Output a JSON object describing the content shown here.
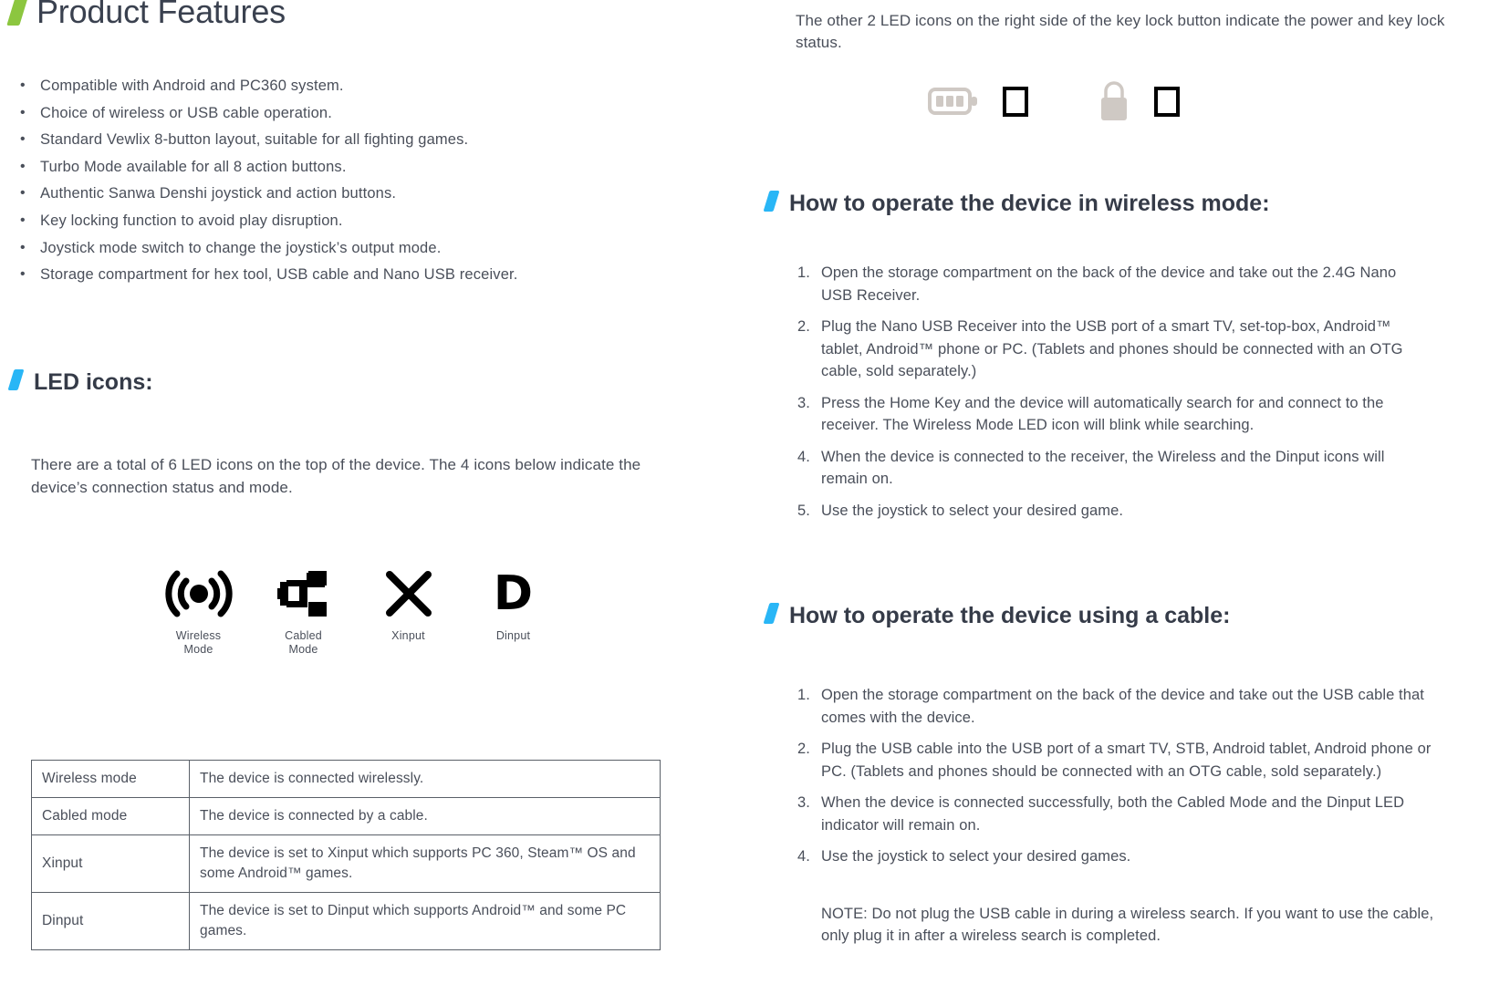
{
  "left": {
    "product_features": {
      "title": "Product Features",
      "accent_color": "#8cc63f",
      "items": [
        "Compatible with Android and PC360 system.",
        "Choice of wireless or USB cable operation.",
        "Standard Vewlix 8-button layout, suitable for all fighting games.",
        "Turbo Mode available for all 8 action buttons.",
        "Authentic Sanwa Denshi joystick and action buttons.",
        "Key locking function to avoid play disruption.",
        "Joystick mode switch to change the joystick’s output mode.",
        "Storage compartment for hex tool, USB cable and Nano USB receiver."
      ]
    },
    "led_icons": {
      "title": "LED icons:",
      "accent_color": "#29b6f6",
      "intro": "There are a total of 6 LED icons on the top of the device. The 4 icons below indicate the device’s connection status and mode.",
      "icon_row": [
        {
          "icon": "wireless-signal-icon",
          "caption_line1": "Wireless",
          "caption_line2": "Mode"
        },
        {
          "icon": "cable-connector-icon",
          "caption_line1": "Cabled",
          "caption_line2": "Mode"
        },
        {
          "icon": "x-cross-icon",
          "caption_line1": "Xinput",
          "caption_line2": ""
        },
        {
          "icon": "letter-d-icon",
          "caption_line1": "Dinput",
          "caption_line2": "",
          "glyph": "D"
        }
      ],
      "table": [
        {
          "key": "Wireless mode",
          "value": "The device is connected wirelessly."
        },
        {
          "key": "Cabled mode",
          "value": "The device is connected by a cable."
        },
        {
          "key": "Xinput",
          "value": "The device is set to Xinput which supports PC 360, Steam™ OS and some Android™ games."
        },
        {
          "key": "Dinput",
          "value": "The device is set to Dinput which supports Android™ and some PC games."
        }
      ]
    }
  },
  "right": {
    "key_lock_text": "The other 2 LED icons on the right side of the key lock button indicate the power and key lock status.",
    "status_icons": [
      {
        "icon": "battery-full-icon",
        "color": "#cfc9c4"
      },
      {
        "icon": "square-outline-icon",
        "color": "#000000"
      },
      {
        "icon": "padlock-closed-icon",
        "color": "#cfc9c4"
      },
      {
        "icon": "square-outline-icon",
        "color": "#000000"
      }
    ],
    "wireless_section": {
      "title": "How to operate the device in wireless mode:",
      "accent_color": "#29b6f6",
      "steps": [
        {
          "num": "1.",
          "text": "Open the storage compartment on the back of the device and take out the 2.4G Nano USB Receiver."
        },
        {
          "num": "2.",
          "text": "Plug the Nano USB Receiver into the USB port of a smart TV, set-top-box, Android™ tablet, Android™ phone or PC. (Tablets and phones should be connected with an OTG cable, sold separately.)"
        },
        {
          "num": "3.",
          "text": "Press the Home Key and the device will automatically search for and connect to the receiver. The Wireless Mode LED icon will blink while searching."
        },
        {
          "num": "4.",
          "text": "When the device is connected to the receiver, the Wireless and the Dinput icons will remain on."
        },
        {
          "num": "5.",
          "text": "Use the joystick to select your desired game."
        }
      ]
    },
    "cable_section": {
      "title": "How to operate the device using a cable:",
      "accent_color": "#29b6f6",
      "steps": [
        {
          "num": "1.",
          "text": "Open the storage compartment on the back of the device and take out the USB cable that comes with the device."
        },
        {
          "num": "2.",
          "text": "Plug the USB cable into the USB port of a smart TV, STB, Android tablet, Android phone or PC. (Tablets and phones should be connected with an OTG cable, sold separately.)"
        },
        {
          "num": "3.",
          "text": "When the device is connected successfully, both the Cabled Mode and the Dinput LED indicator will remain on."
        },
        {
          "num": "4.",
          "text": "Use the joystick to select your desired games."
        }
      ],
      "note": "NOTE: Do not plug the USB cable in during a wireless search. If you want to use the cable, only plug it in after a wireless search is completed."
    }
  }
}
